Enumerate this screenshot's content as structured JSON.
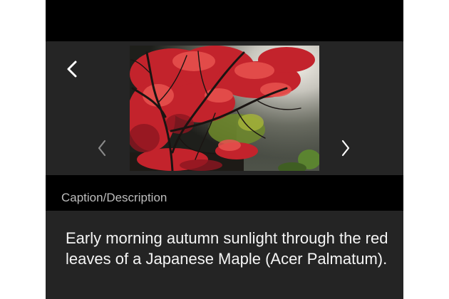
{
  "viewer": {
    "photo_alt": "Red Japanese maple tree in autumn sunlight",
    "back_icon": "chevron-left-icon",
    "prev_icon": "chevron-left-icon",
    "next_icon": "chevron-right-icon"
  },
  "caption": {
    "label": "Caption/Description",
    "text": "Early morning autumn sunlight through the red leaves of a Japanese Maple (Acer Palmatum)."
  },
  "colors": {
    "background": "#242424",
    "header_bar": "#000000",
    "label_text": "#bdbdbd",
    "body_text": "#f5f5f5",
    "disabled_chevron": "#8a8a8a"
  }
}
